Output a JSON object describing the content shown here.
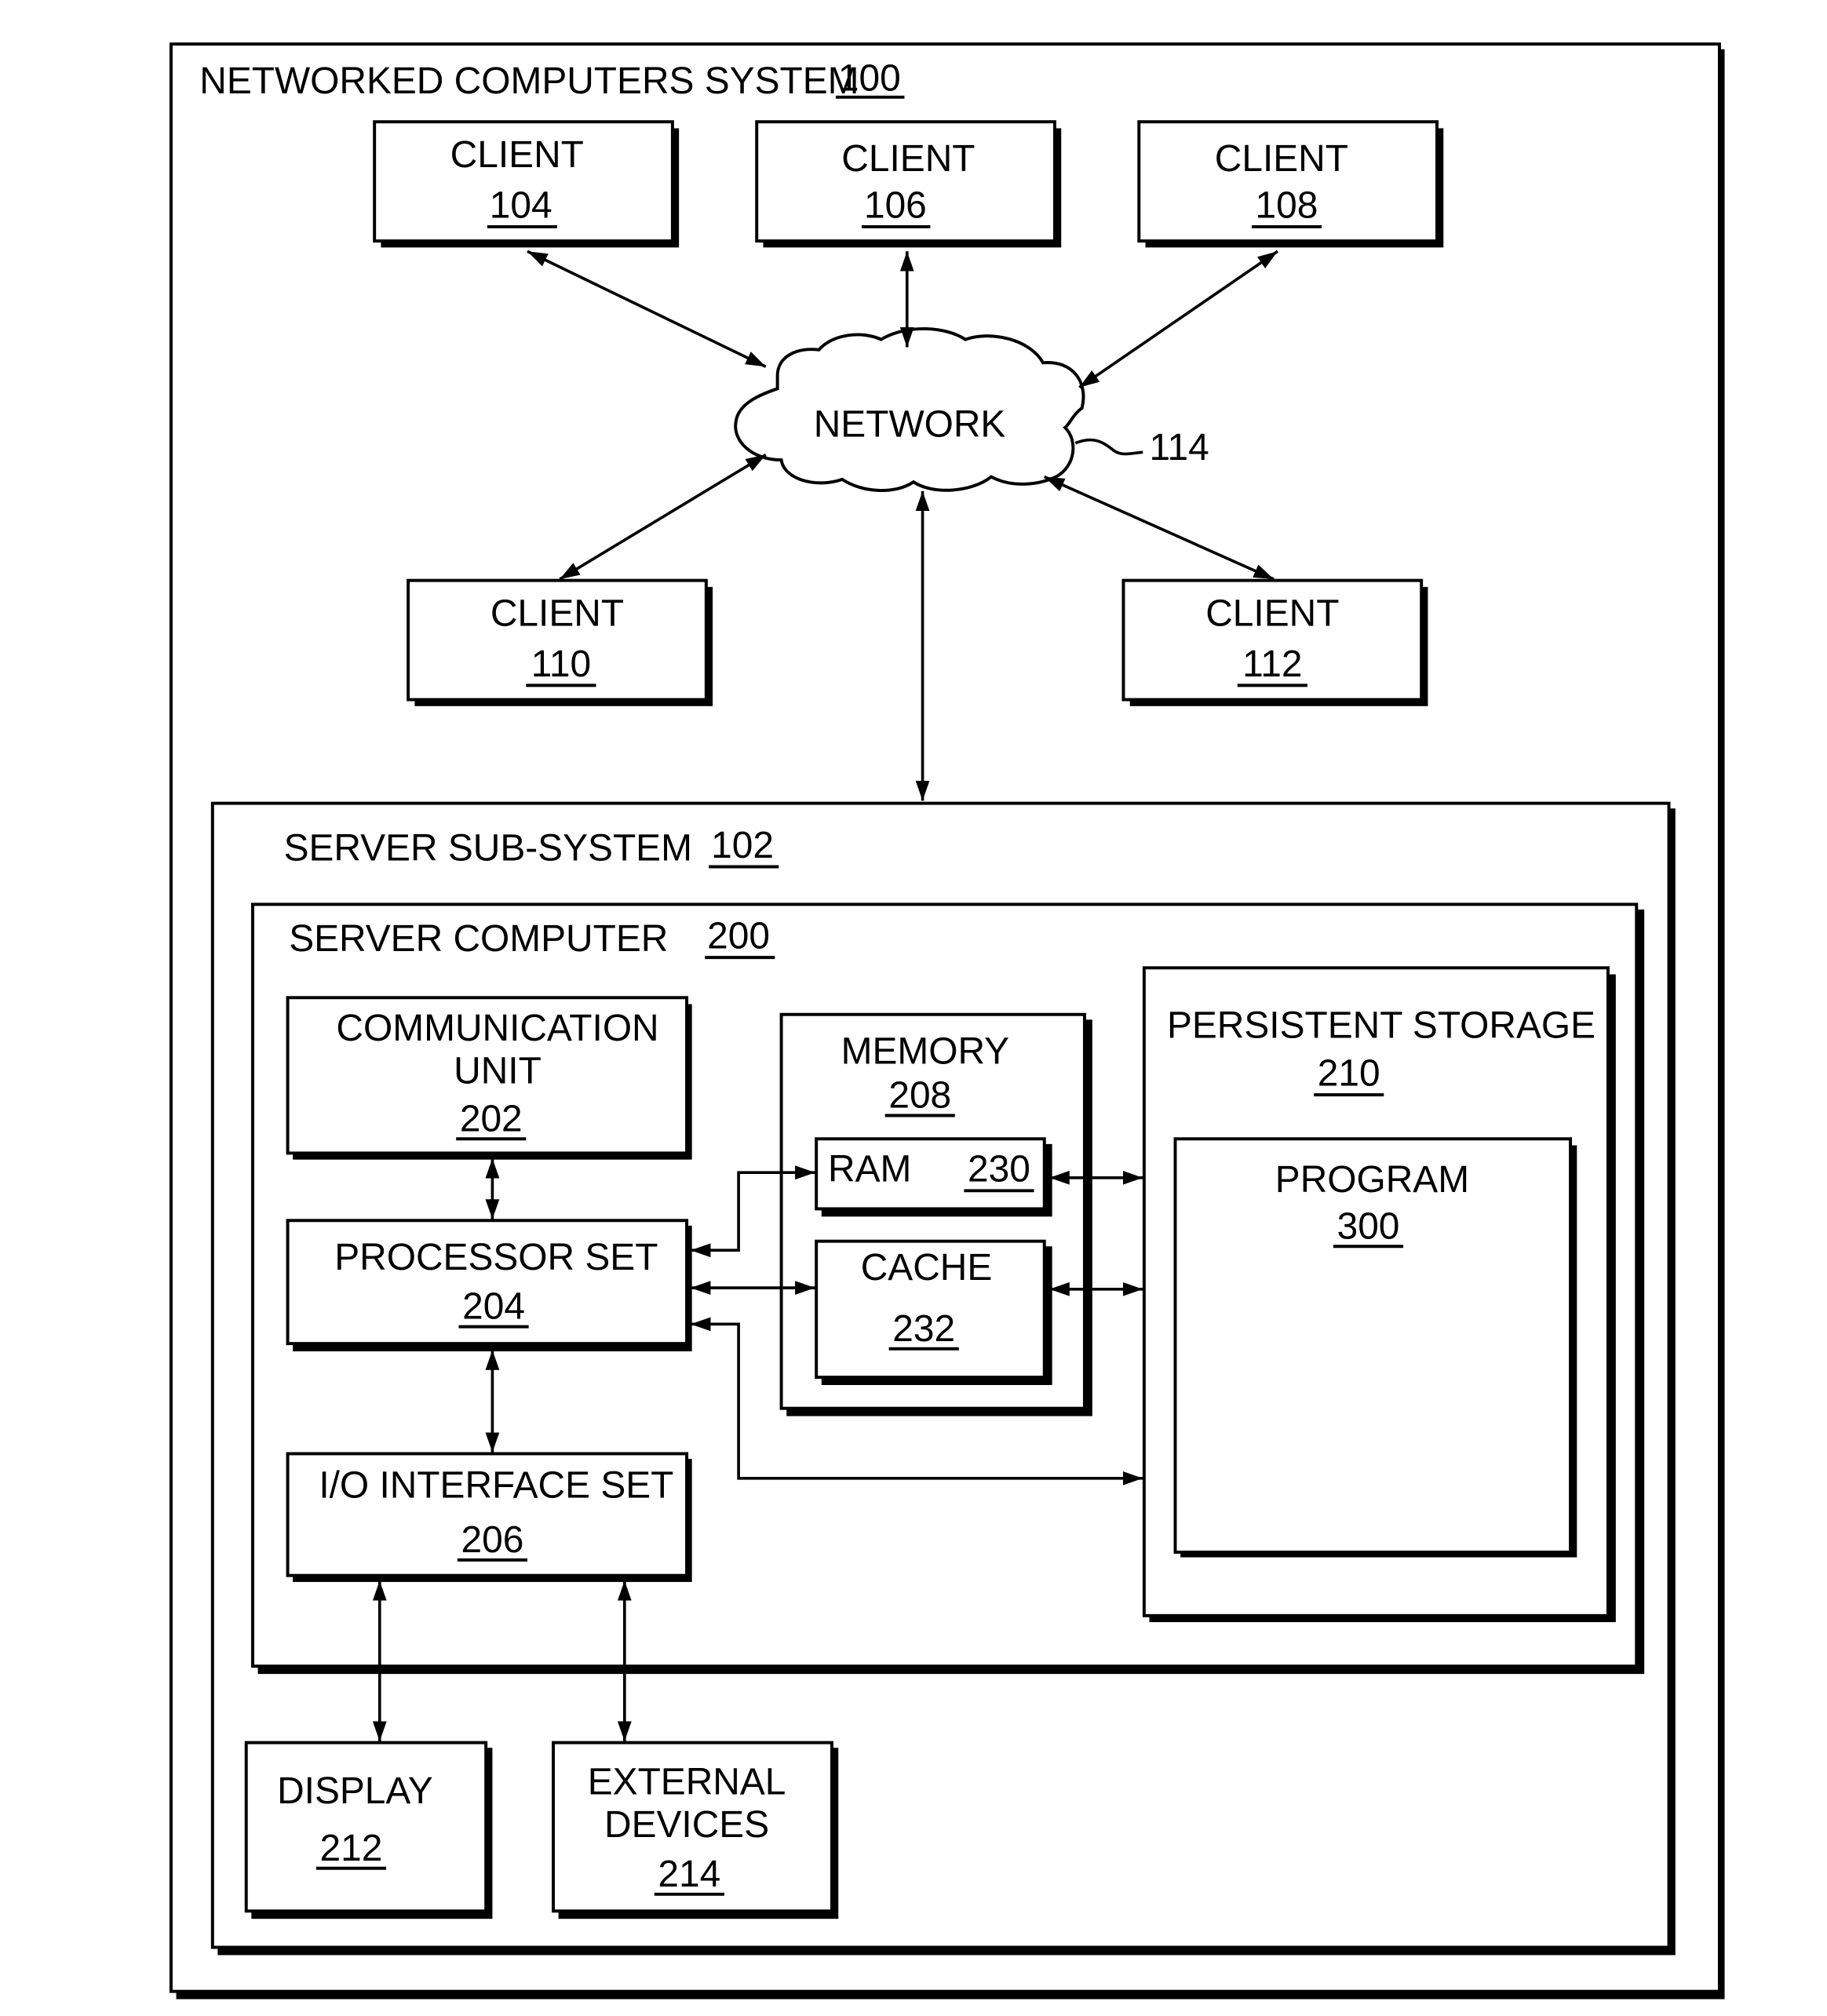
{
  "figure": {
    "system": {
      "title": "NETWORKED COMPUTERS SYSTEM",
      "ref": "100"
    },
    "clients": [
      {
        "label": "CLIENT",
        "ref": "104"
      },
      {
        "label": "CLIENT",
        "ref": "106"
      },
      {
        "label": "CLIENT",
        "ref": "108"
      },
      {
        "label": "CLIENT",
        "ref": "110"
      },
      {
        "label": "CLIENT",
        "ref": "112"
      }
    ],
    "network": {
      "label": "NETWORK",
      "ref": "114"
    },
    "server_subsystem": {
      "title": "SERVER SUB-SYSTEM",
      "ref": "102"
    },
    "server_computer": {
      "title": "SERVER COMPUTER",
      "ref": "200"
    },
    "communication_unit": {
      "line1": "COMMUNICATION",
      "line2": "UNIT",
      "ref": "202"
    },
    "processor_set": {
      "label": "PROCESSOR SET",
      "ref": "204"
    },
    "io_interface_set": {
      "label": "I/O INTERFACE SET",
      "ref": "206"
    },
    "memory": {
      "label": "MEMORY",
      "ref": "208"
    },
    "ram": {
      "label": "RAM",
      "ref": "230"
    },
    "cache": {
      "label": "CACHE",
      "ref": "232"
    },
    "persistent_storage": {
      "label": "PERSISTENT STORAGE",
      "ref": "210"
    },
    "program": {
      "label": "PROGRAM",
      "ref": "300"
    },
    "display": {
      "label": "DISPLAY",
      "ref": "212"
    },
    "external_devices": {
      "line1": "EXTERNAL",
      "line2": "DEVICES",
      "ref": "214"
    }
  }
}
